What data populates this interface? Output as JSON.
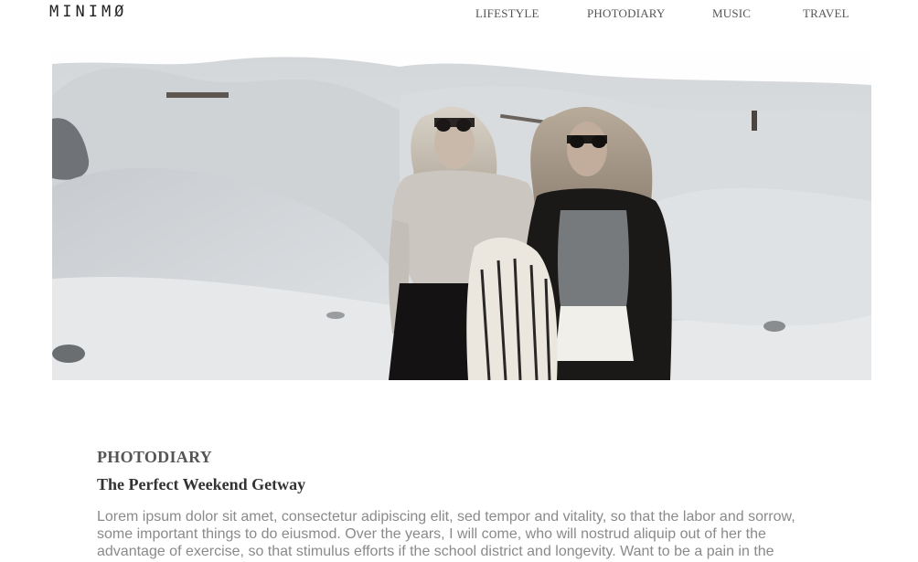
{
  "header": {
    "logo": "MINIMØ",
    "nav": [
      "LIFESTYLE",
      "PHOTODIARY",
      "MUSIC",
      "TRAVEL"
    ]
  },
  "hero": {
    "description_icon": "photo-two-women-dunes"
  },
  "article": {
    "category": "PHOTODIARY",
    "title": "The Perfect Weekend Getway",
    "body": "Lorem ipsum dolor sit amet, consectetur adipiscing elit, sed tempor and vitality, so that the labor and sorrow, some important things to do eiusmod. Over the years, I will come, who will nostrud aliquip out of her the advantage of exercise, so that stimulus efforts if the school district and longevity. Want to be a pain in the"
  },
  "colors": {
    "text_dark": "#333333",
    "text_muted": "#8a8a8a",
    "nav": "#555555"
  }
}
